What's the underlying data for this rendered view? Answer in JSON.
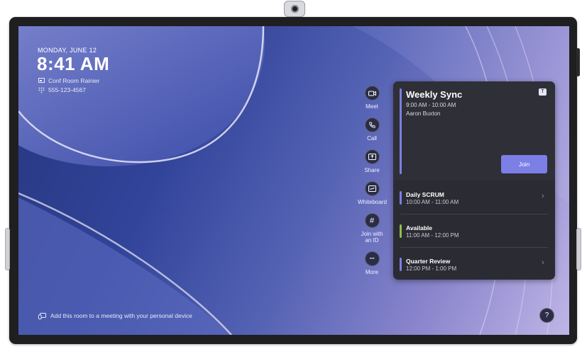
{
  "clock": {
    "date": "MONDAY, JUNE 12",
    "time": "8:41 AM"
  },
  "room": {
    "name": "Conf Room Rainier",
    "phone": "555-123-4567"
  },
  "actions": [
    {
      "label": "Meet",
      "icon": "video-camera-icon"
    },
    {
      "label": "Call",
      "icon": "phone-icon"
    },
    {
      "label": "Share",
      "icon": "share-screen-icon"
    },
    {
      "label": "Whiteboard",
      "icon": "whiteboard-icon"
    },
    {
      "label": "Join with an ID",
      "icon": "hash-icon",
      "glyph": "#"
    },
    {
      "label": "More",
      "icon": "more-icon",
      "glyph": "···"
    }
  ],
  "current_meeting": {
    "title": "Weekly Sync",
    "time": "9:00 AM - 10:00 AM",
    "organizer": "Aaron Buxton",
    "join_label": "Join",
    "accent": "#7b7fe6"
  },
  "agenda": [
    {
      "title": "Daily SCRUM",
      "time": "10:00 AM - 11:00 AM",
      "accent": "#7b7fe6",
      "has_chevron": true
    },
    {
      "title": "Available",
      "time": "11:00 AM - 12:00 PM",
      "accent": "#8fbf4d",
      "has_chevron": false
    },
    {
      "title": "Quarter Review",
      "time": "12:00 PM - 1:00 PM",
      "accent": "#7b7fe6",
      "has_chevron": true
    }
  ],
  "footer": {
    "text": "Add this room to a meeting with your personal device"
  },
  "help": {
    "glyph": "?"
  }
}
